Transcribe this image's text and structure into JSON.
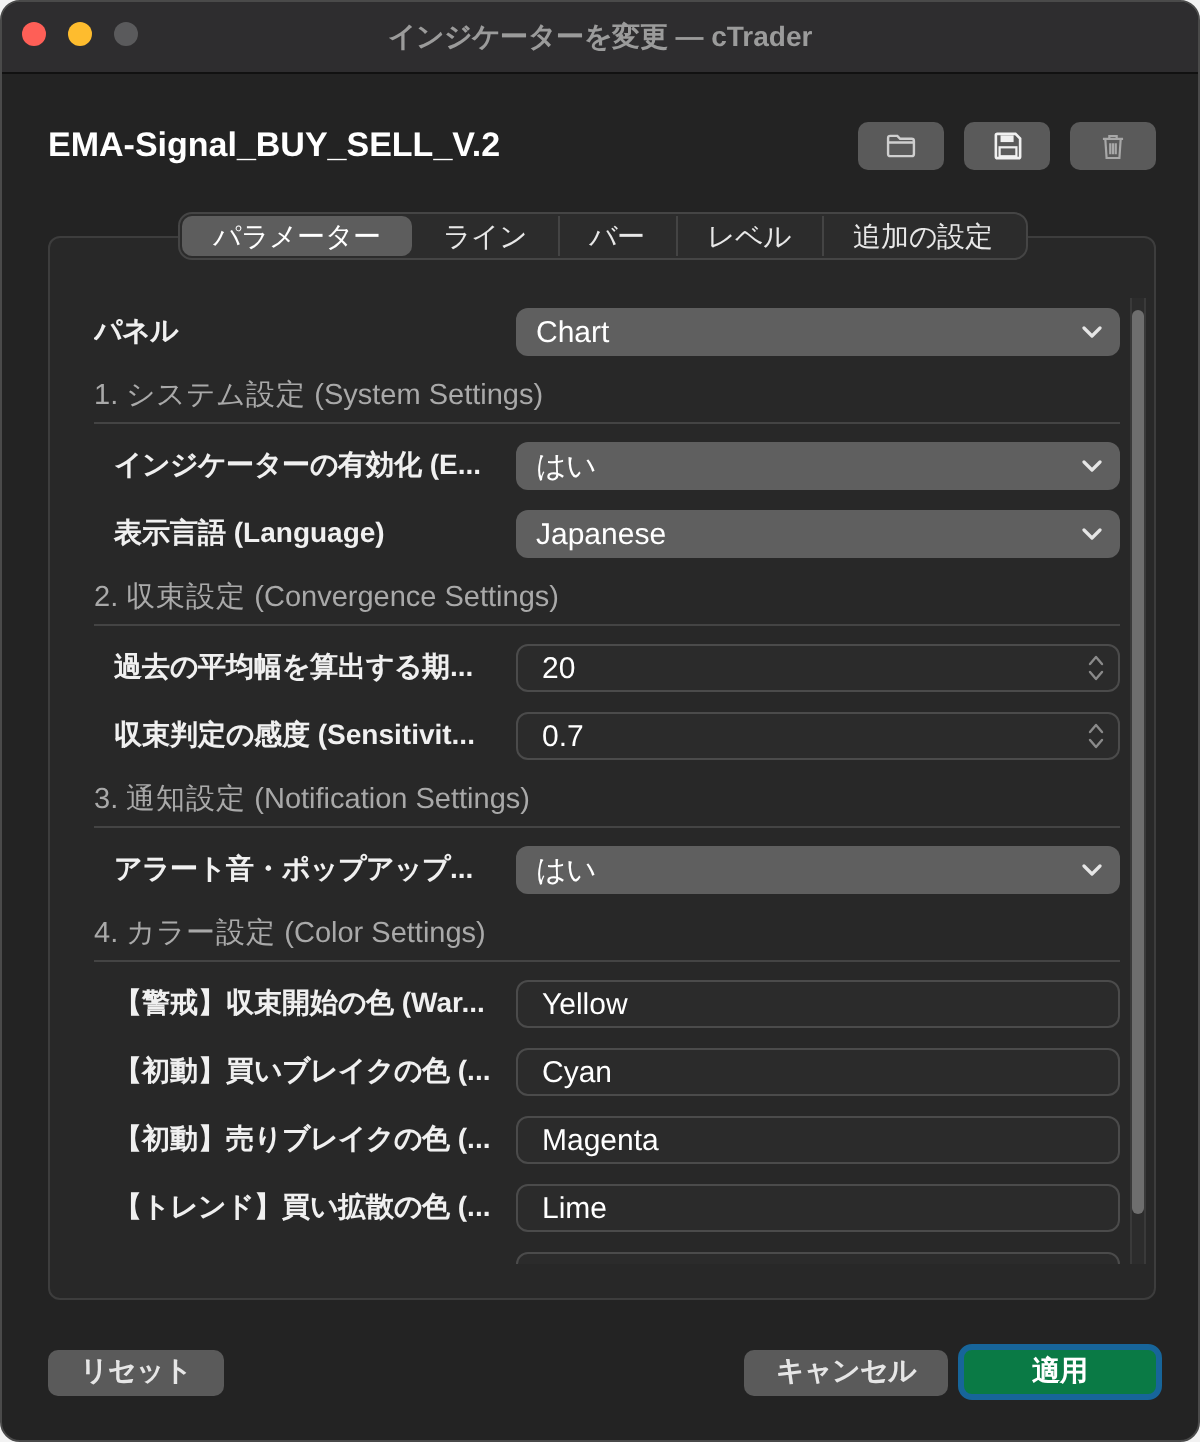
{
  "window": {
    "title": "インジケーターを変更 — cTrader",
    "controls": [
      {
        "kind": "close",
        "disabled": false
      },
      {
        "kind": "minimize",
        "disabled": false
      },
      {
        "kind": "zoom",
        "disabled": true
      }
    ]
  },
  "indicator_name": "EMA-Signal_BUY_SELL_V.2",
  "toolbar_buttons": [
    {
      "kind": "folder"
    },
    {
      "kind": "save"
    },
    {
      "kind": "delete"
    }
  ],
  "tabs": [
    {
      "label": "パラメーター",
      "selected": true
    },
    {
      "label": "ライン",
      "selected": false
    },
    {
      "label": "バー",
      "selected": false
    },
    {
      "label": "レベル",
      "selected": false
    },
    {
      "label": "追加の設定",
      "selected": false
    }
  ],
  "parameters": {
    "panel": {
      "kind": "dropdown",
      "label": "パネル",
      "value": "Chart"
    },
    "sections": [
      {
        "title": "1. システム設定 (System Settings)",
        "rows": [
          {
            "kind": "dropdown",
            "label": "インジケーターの有効化 (E...",
            "value": "はい"
          },
          {
            "kind": "dropdown",
            "label": "表示言語 (Language)",
            "value": "Japanese"
          }
        ]
      },
      {
        "title": "2. 収束設定 (Convergence Settings)",
        "rows": [
          {
            "kind": "number",
            "label": "過去の平均幅を算出する期...",
            "value": "20"
          },
          {
            "kind": "number",
            "label": "収束判定の感度 (Sensitivit...",
            "value": "0.7"
          }
        ]
      },
      {
        "title": "3. 通知設定 (Notification Settings)",
        "rows": [
          {
            "kind": "dropdown",
            "label": "アラート音・ポップアップ...",
            "value": "はい"
          }
        ]
      },
      {
        "title": "4. カラー設定 (Color Settings)",
        "rows": [
          {
            "kind": "color",
            "label": "【警戒】収束開始の色 (War...",
            "value": "Yellow"
          },
          {
            "kind": "color",
            "label": "【初動】買いブレイクの色 (...",
            "value": "Cyan"
          },
          {
            "kind": "color",
            "label": "【初動】売りブレイクの色 (...",
            "value": "Magenta"
          },
          {
            "kind": "color",
            "label": "【トレンド】買い拡散の色 (...",
            "value": "Lime"
          },
          {
            "kind": "color"
          }
        ]
      }
    ]
  },
  "footer_buttons": {
    "reset": "リセット",
    "cancel": "キャンセル",
    "apply": "適用"
  }
}
